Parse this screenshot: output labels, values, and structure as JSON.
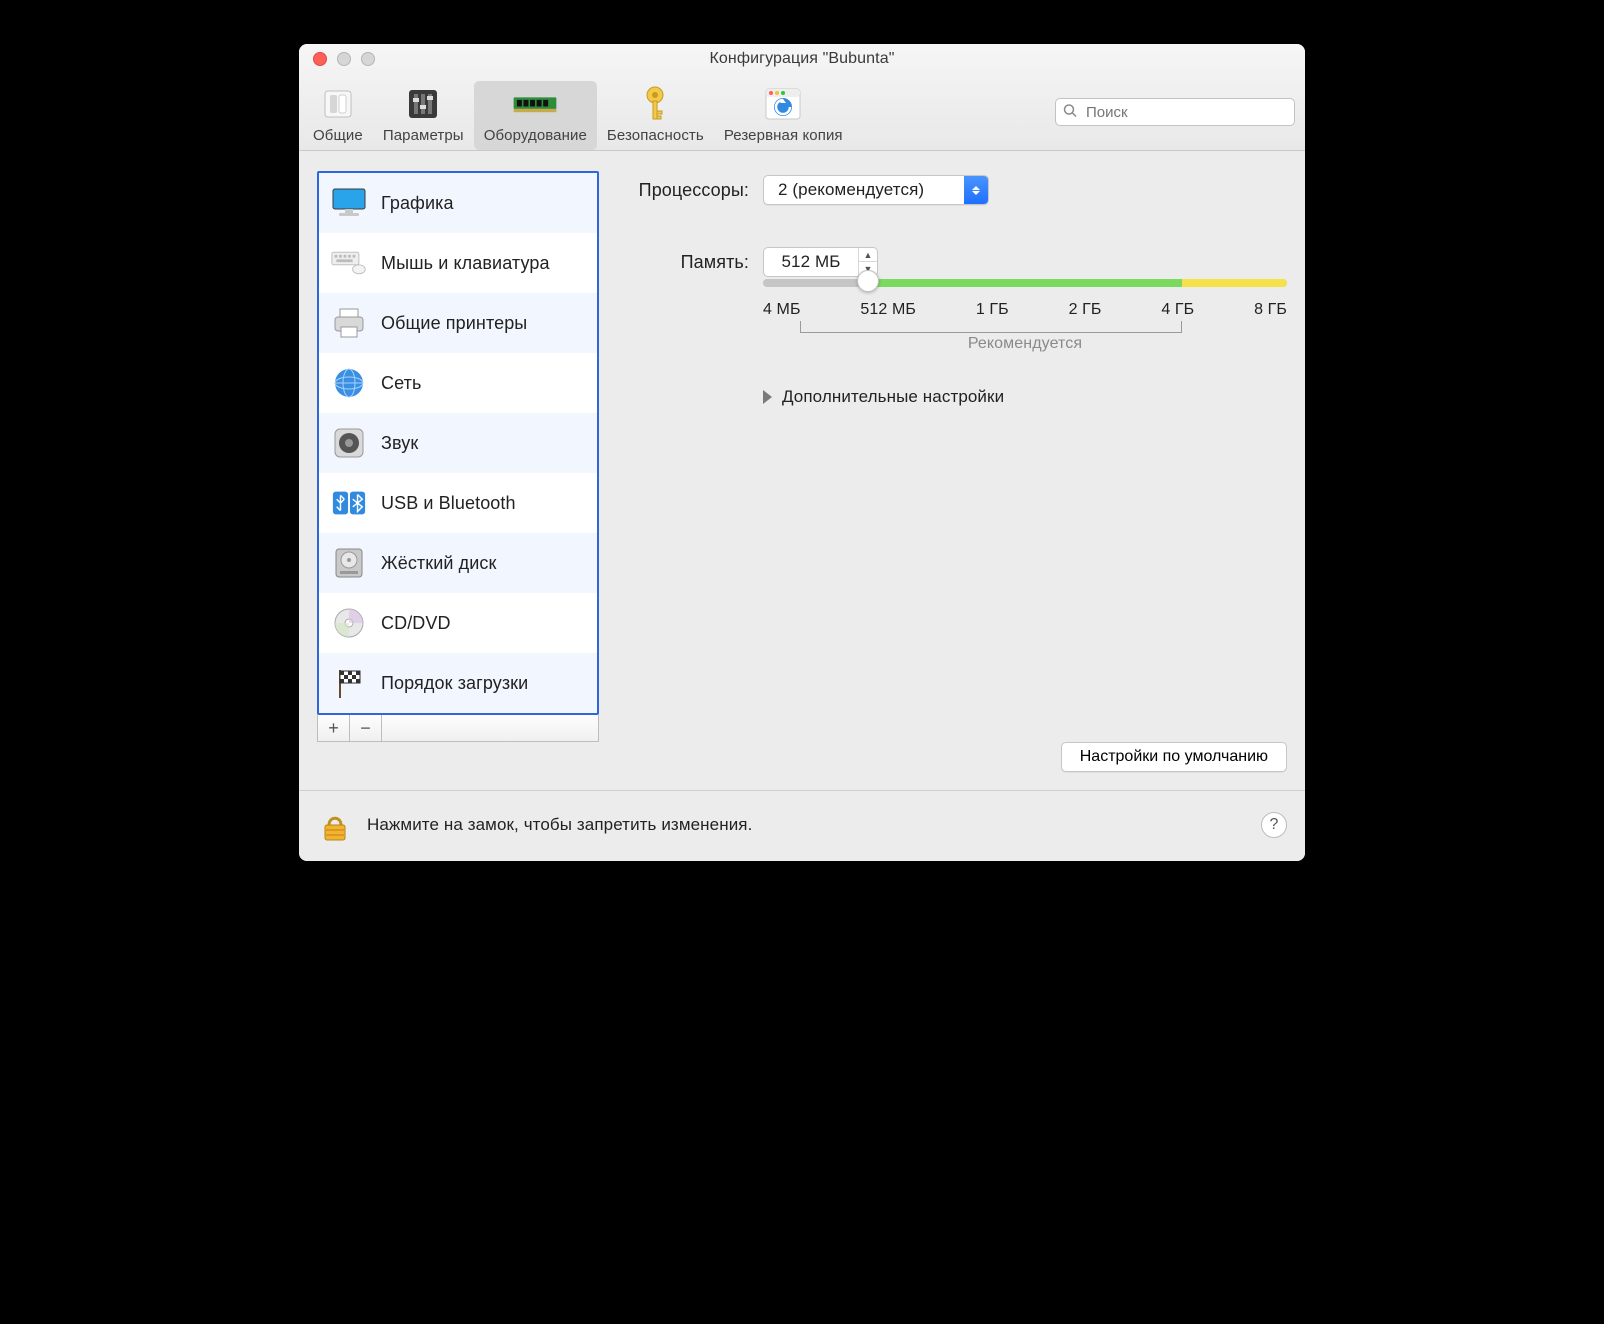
{
  "window": {
    "title": "Конфигурация \"Bubunta\""
  },
  "toolbar": {
    "tabs": [
      {
        "id": "general",
        "label": "Общие"
      },
      {
        "id": "params",
        "label": "Параметры"
      },
      {
        "id": "hardware",
        "label": "Оборудование"
      },
      {
        "id": "security",
        "label": "Безопасность"
      },
      {
        "id": "backup",
        "label": "Резервная копия"
      }
    ],
    "selected": "hardware",
    "search_placeholder": "Поиск"
  },
  "sidebar": {
    "items": [
      {
        "id": "graphics",
        "label": "Графика"
      },
      {
        "id": "mouse-kbd",
        "label": "Мышь и клавиатура"
      },
      {
        "id": "printers",
        "label": "Общие принтеры"
      },
      {
        "id": "network",
        "label": "Сеть"
      },
      {
        "id": "sound",
        "label": "Звук"
      },
      {
        "id": "usb-bt",
        "label": "USB и Bluetooth"
      },
      {
        "id": "hdd",
        "label": "Жёсткий диск"
      },
      {
        "id": "cddvd",
        "label": "CD/DVD"
      },
      {
        "id": "bootorder",
        "label": "Порядок загрузки"
      }
    ],
    "add": "+",
    "remove": "−"
  },
  "panel": {
    "cpu_label": "Процессоры:",
    "cpu_value": "2 (рекомендуется)",
    "mem_label": "Память:",
    "mem_value": "512 МБ",
    "slider": {
      "ticks": [
        "4 МБ",
        "512 МБ",
        "1 ГБ",
        "2 ГБ",
        "4 ГБ",
        "8 ГБ"
      ],
      "recommended_label": "Рекомендуется",
      "thumb_percent": 20,
      "green_start_percent": 20,
      "green_end_percent": 80,
      "yellow_start_percent": 80,
      "yellow_end_percent": 100,
      "reco_left_percent": 7,
      "reco_right_percent": 80
    },
    "advanced_label": "Дополнительные настройки",
    "defaults_button": "Настройки по умолчанию"
  },
  "footer": {
    "lock_text": "Нажмите на замок, чтобы запретить изменения.",
    "help": "?"
  }
}
